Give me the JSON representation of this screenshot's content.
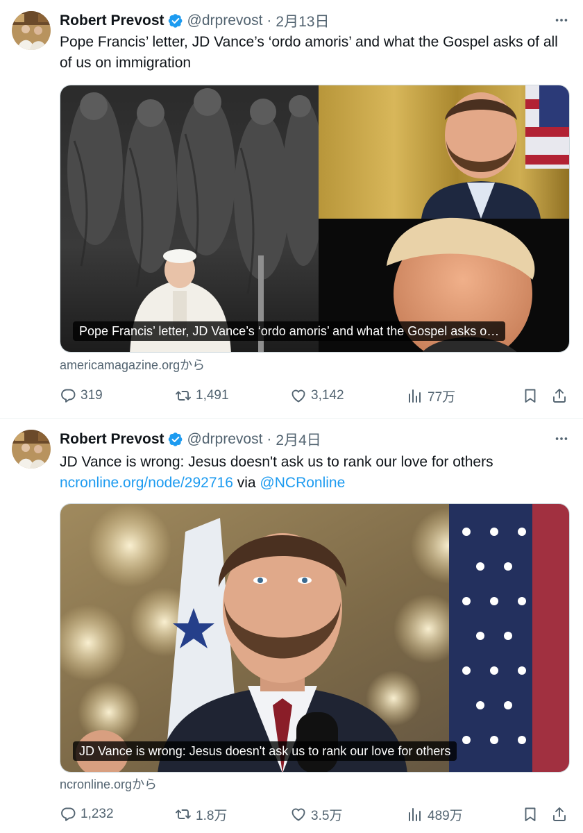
{
  "tweets": [
    {
      "author": "Robert Prevost",
      "handle": "@drprevost",
      "separator": "·",
      "date": "2月13日",
      "text": "Pope Francis’ letter, JD Vance’s ‘ordo amoris’ and what the Gospel asks of all of us on immigration",
      "card_caption": "Pope Francis’ letter, JD Vance’s ‘ordo amoris’ and what the Gospel asks o…",
      "source": "americamagazine.orgから",
      "replies": "319",
      "retweets": "1,491",
      "likes": "3,142",
      "views": "77万"
    },
    {
      "author": "Robert Prevost",
      "handle": "@drprevost",
      "separator": "·",
      "date": "2月4日",
      "text": "JD Vance is wrong: Jesus doesn't ask us to rank our love for others",
      "link": "ncronline.org/node/292716",
      "via": "via",
      "mention": "@NCRonline",
      "card_caption": "JD Vance is wrong: Jesus doesn't ask us to rank our love for others",
      "source": "ncronline.orgから",
      "replies": "1,232",
      "retweets": "1.8万",
      "likes": "3.5万",
      "views": "489万"
    }
  ],
  "colors": {
    "text": "#0f1419",
    "secondary": "#536471",
    "link": "#1d9bf0",
    "verified": "#1d9bf0"
  },
  "icons": [
    "verified-badge-icon",
    "more-icon",
    "reply-icon",
    "retweet-icon",
    "like-icon",
    "views-icon",
    "bookmark-icon",
    "share-icon"
  ]
}
